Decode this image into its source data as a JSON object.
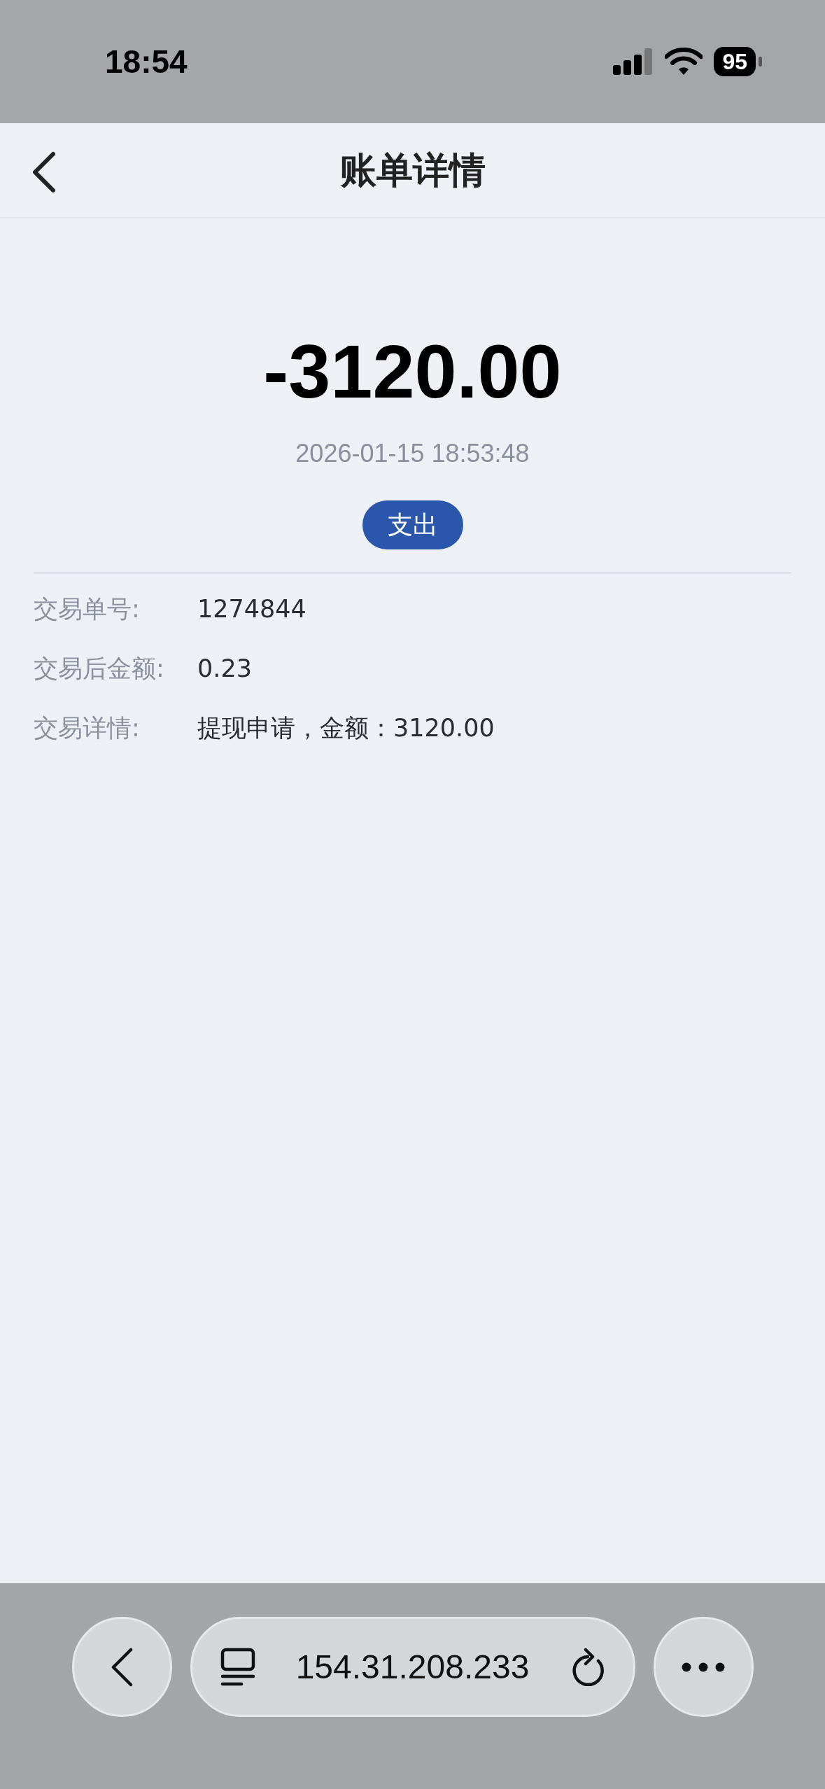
{
  "status_bar": {
    "time": "18:54",
    "battery": "95"
  },
  "header": {
    "title": "账单详情"
  },
  "transaction": {
    "amount": "-3120.00",
    "datetime": "2026-01-15 18:53:48",
    "type_badge": "支出"
  },
  "details": [
    {
      "label": "交易单号:",
      "value": "1274844"
    },
    {
      "label": "交易后金额:",
      "value": "0.23"
    },
    {
      "label": "交易详情:",
      "value": "提现申请，金额：3120.00"
    }
  ],
  "browser_bar": {
    "url": "154.31.208.233"
  }
}
